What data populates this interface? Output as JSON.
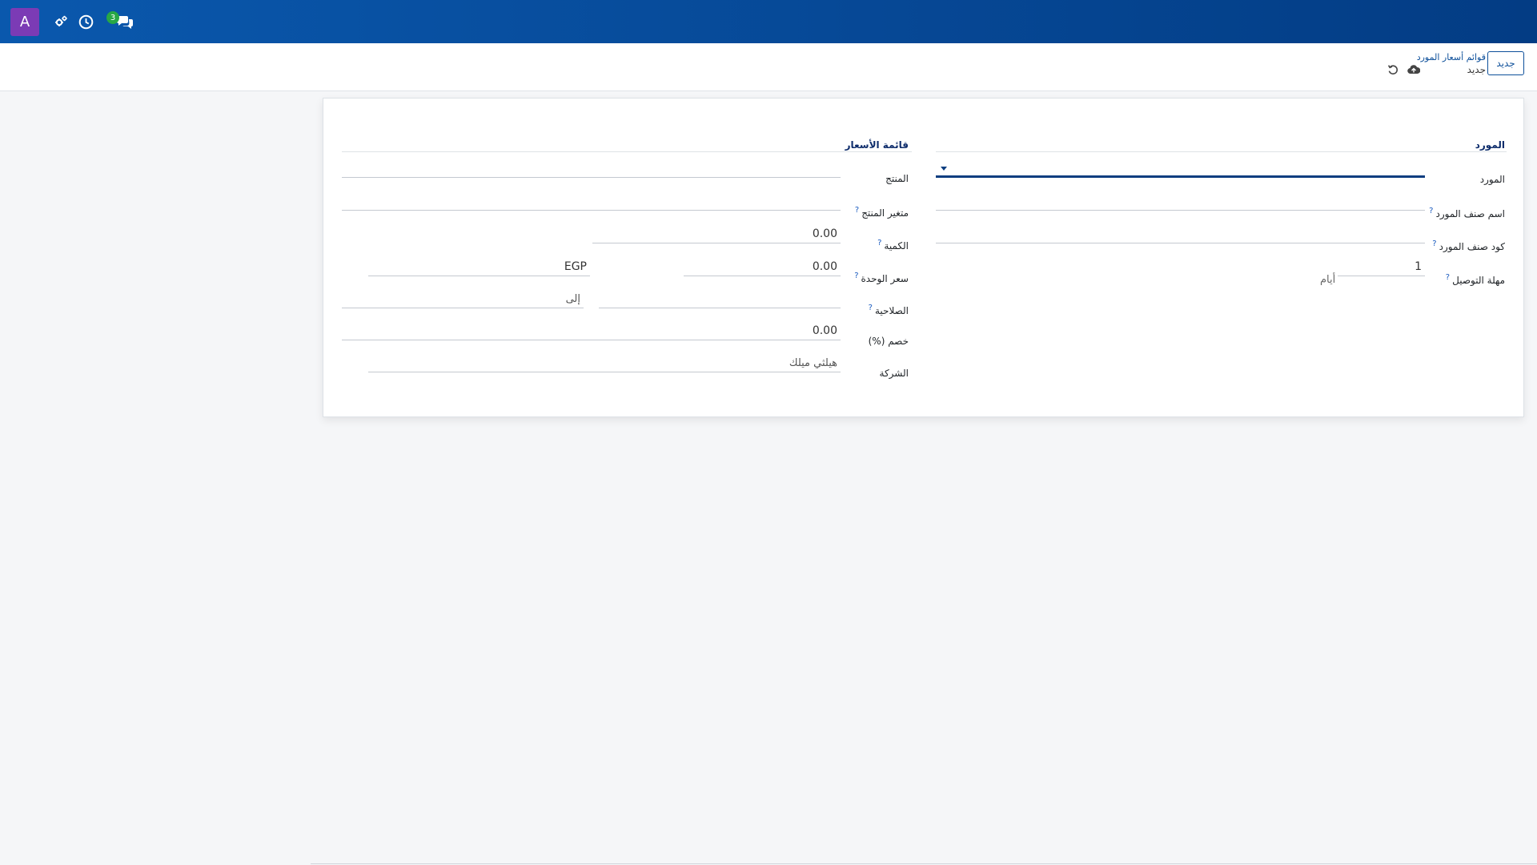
{
  "navbar": {
    "avatar_letter": "A",
    "icons": [
      "settings-icon",
      "clock-icon",
      "chat-icon"
    ],
    "message_count": "3"
  },
  "control_panel": {
    "new_button": "جديد",
    "breadcrumb_parent": "قوائم أسعار المورد",
    "breadcrumb_current": "جديد",
    "icons": [
      "cloud-save-icon",
      "discard-icon"
    ]
  },
  "form": {
    "vendor_group": {
      "title": "المورد",
      "vendor_label": "المورد",
      "vendor_product_name_label": "اسم صنف المورد",
      "vendor_product_code_label": "كود صنف المورد",
      "delivery_lead_time_label": "مهلة التوصيل",
      "delivery_lead_time_value": "1",
      "delivery_lead_time_unit": "أيام"
    },
    "pricelist_group": {
      "title": "قائمة الأسعار",
      "product_label": "المنتج",
      "product_variant_label": "متغير المنتج",
      "quantity_label": "الكمية",
      "quantity_value": "0.00",
      "unit_price_label": "سعر الوحدة",
      "unit_price_value": "0.00",
      "currency": "EGP",
      "validity_label": "الصلاحية",
      "validity_to": "إلى",
      "discount_label": "خصم (%)",
      "discount_value": "0.00",
      "company_label": "الشركة",
      "company_value": "هيلثي ميلك"
    },
    "help_mark": "?"
  },
  "colors": {
    "navbar_start": "#0a58ad",
    "navbar_end": "#033c84",
    "avatar": "#7b3bb5",
    "badge": "#28a745",
    "primary": "#0d4f9a"
  }
}
